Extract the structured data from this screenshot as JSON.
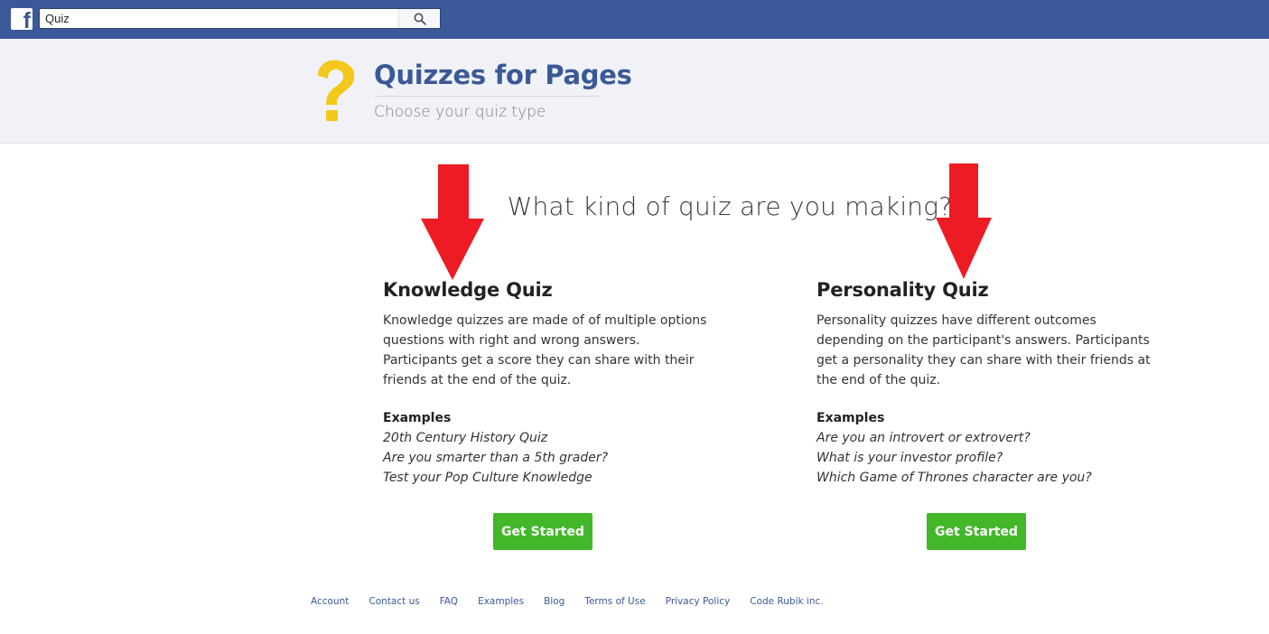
{
  "topbar": {
    "logo": "facebook-icon",
    "search": {
      "value": "Quiz",
      "placeholder": "",
      "icon": "search-icon"
    }
  },
  "header": {
    "icon": "question-mark-icon",
    "title": "Quizzes for Pages",
    "subtitle": "Choose your quiz type"
  },
  "main": {
    "heading": "What kind of quiz are you making?",
    "quizzes": [
      {
        "title": "Knowledge Quiz",
        "description": "Knowledge quizzes are made of of multiple options questions with right and wrong answers. Participants get a score they can share with their friends at the end of the quiz.",
        "examples_label": "Examples",
        "examples": [
          "20th Century History Quiz",
          "Are you smarter than a 5th grader?",
          "Test your Pop Culture Knowledge"
        ],
        "button": "Get Started"
      },
      {
        "title": "Personality Quiz",
        "description": "Personality quizzes have different outcomes depending on the participant's answers. Participants get a personality they can share with their friends at the end of the quiz.",
        "examples_label": "Examples",
        "examples": [
          "Are you an introvert or extrovert?",
          "What is your investor profile?",
          "Which Game of Thrones character are you?"
        ],
        "button": "Get Started"
      }
    ]
  },
  "footer": {
    "links": [
      "Account",
      "Contact us",
      "FAQ",
      "Examples",
      "Blog",
      "Terms of Use",
      "Privacy Policy",
      "Code Rubik inc."
    ]
  },
  "colors": {
    "facebook_blue": "#3b5998",
    "header_band": "#f1f2f7",
    "accent_yellow": "#f2c81d",
    "button_green": "#42b72a",
    "annotation_arrow": "#ed1c24"
  }
}
